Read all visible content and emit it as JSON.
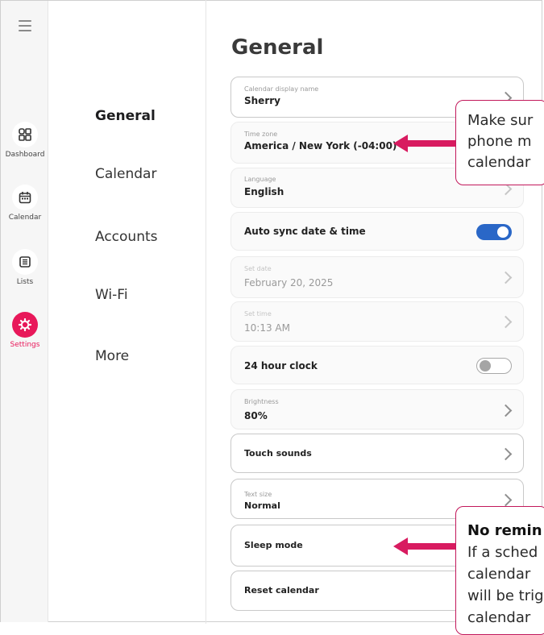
{
  "rail": {
    "items": [
      {
        "label": "Dashboard",
        "icon": "dashboard-icon"
      },
      {
        "label": "Calendar",
        "icon": "calendar-icon"
      },
      {
        "label": "Lists",
        "icon": "list-icon"
      },
      {
        "label": "Settings",
        "icon": "gear-icon"
      }
    ]
  },
  "categories": [
    "General",
    "Calendar",
    "Accounts",
    "Wi-Fi",
    "More"
  ],
  "page_title": "General",
  "settings": {
    "display_name": {
      "label": "Calendar display name",
      "value": "Sherry"
    },
    "time_zone": {
      "label": "Time zone",
      "value": "America / New York (-04:00)"
    },
    "language": {
      "label": "Language",
      "value": "English"
    },
    "auto_sync": {
      "label": "Auto sync date & time",
      "state": "on"
    },
    "set_date": {
      "label": "Set date",
      "value": "February 20, 2025"
    },
    "set_time": {
      "label": "Set time",
      "value": "10:13 AM"
    },
    "clock24": {
      "label": "24 hour clock",
      "state": "off"
    },
    "brightness": {
      "label": "Brightness",
      "value": "80%"
    },
    "touch_sounds": {
      "label": "Touch sounds"
    },
    "text_size": {
      "label": "Text size",
      "value": "Normal"
    },
    "sleep_mode": {
      "label": "Sleep mode"
    },
    "reset_calendar": {
      "label": "Reset calendar"
    }
  },
  "callouts": {
    "timezone_note": {
      "line1": "Make sur",
      "line2": "phone m",
      "line3": "calendar"
    },
    "sleep_note": {
      "title": "No remin",
      "line1": "If a sched",
      "line2": "calendar",
      "line3": "will be trig",
      "line4": "calendar"
    }
  },
  "colors": {
    "accent": "#e8185a",
    "toggle_on": "#2a67c7",
    "callout_border": "#c2185b"
  }
}
